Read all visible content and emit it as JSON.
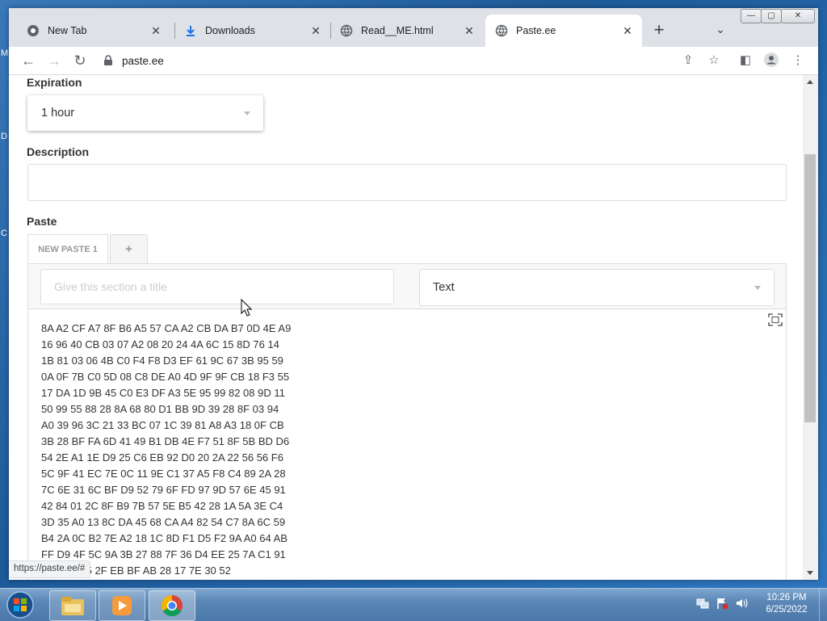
{
  "desktop": {
    "edge_glyphs": [
      "M",
      "D",
      "C"
    ]
  },
  "browser": {
    "tabs": [
      {
        "title": "New Tab",
        "icon": "chrome-icon"
      },
      {
        "title": "Downloads",
        "icon": "download-icon"
      },
      {
        "title": "Read__ME.html",
        "icon": "globe-icon"
      },
      {
        "title": "Paste.ee",
        "icon": "globe-icon",
        "active": true
      }
    ],
    "url": "paste.ee",
    "status_url": "https://paste.ee/#"
  },
  "form": {
    "expiration_label": "Expiration",
    "expiration_value": "1 hour",
    "description_label": "Description",
    "description_value": "",
    "paste_label": "Paste",
    "paste_tab_label": "NEW PASTE 1",
    "add_tab_label": "+",
    "section_title_placeholder": "Give this section a title",
    "syntax_value": "Text",
    "content_lines": [
      "8A A2 CF A7 8F B6 A5 57 CA A2 CB DA B7 0D 4E A9",
      "16 96 40 CB 03 07 A2 08 20 24 4A 6C 15 8D 76 14",
      "1B 81 03 06 4B C0 F4 F8 D3 EF 61 9C 67 3B 95 59",
      "0A 0F 7B C0 5D 08 C8 DE A0 4D 9F 9F CB 18 F3 55",
      "17 DA 1D 9B 45 C0 E3 DF A3 5E 95 99 82 08 9D 11",
      "50 99 55 88 28 8A 68 80 D1 BB 9D 39 28 8F 03 94",
      "A0 39 96 3C 21 33 BC 07 1C 39 81 A8 A3 18 0F CB",
      "3B 28 BF FA 6D 41 49 B1 DB 4E F7 51 8F 5B BD D6",
      "54 2E A1 1E D9 25 C6 EB 92 D0 20 2A 22 56 56 F6",
      "5C 9F 41 EC 7E 0C 11 9E C1 37 A5 F8 C4 89 2A 28",
      "7C 6E 31 6C BF D9 52 79 6F FD 97 9D 57 6E 45 91",
      "42 84 01 2C 8F B9 7B 57 5E B5 42 28 1A 5A 3E C4",
      "3D 35 A0 13 8C DA 45 68 CA A4 82 54 C7 8A 6C 59",
      "B4 2A 0C B2 7E A2 18 1C 8D F1 D5 F2 9A A0 64 AB",
      "FF D9 4F 5C 9A 3B 27 88 7F 36 D4 EE 25 7A C1 91",
      "5 7F F7 65 2F EB BF AB 28 17 7E 30 52"
    ]
  },
  "taskbar": {
    "time": "10:26 PM",
    "date": "6/25/2022",
    "apps": [
      "explorer-icon",
      "media-player-icon",
      "chrome-icon"
    ]
  },
  "colors": {
    "tabstrip": "#dee1e6",
    "taskbar": "#5b86b5"
  }
}
